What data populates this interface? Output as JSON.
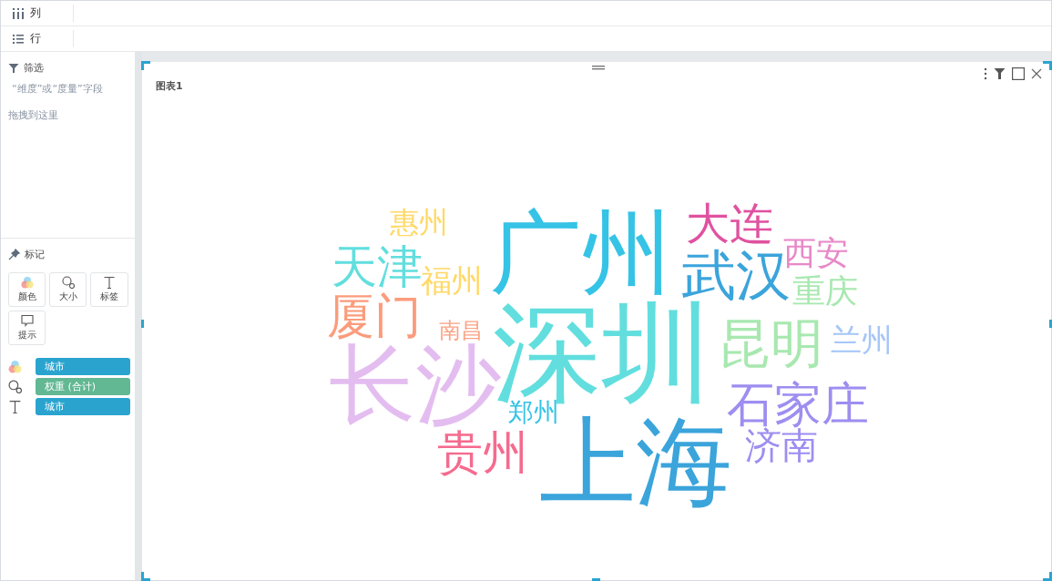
{
  "shelves": [
    {
      "kind": "columns",
      "label": "列"
    },
    {
      "kind": "rows",
      "label": "行"
    }
  ],
  "filter": {
    "title": "筛选",
    "hint": "“维度”或“度量”字段",
    "hint2": "拖拽到这里"
  },
  "marks": {
    "title": "标记",
    "buttons": [
      {
        "kind": "color",
        "label": "颜色"
      },
      {
        "kind": "size",
        "label": "大小"
      },
      {
        "kind": "label",
        "label": "标签"
      },
      {
        "kind": "tooltip",
        "label": "提示"
      }
    ],
    "fields": [
      {
        "kind": "color",
        "label": "城市",
        "color": "#2aa4cf"
      },
      {
        "kind": "size",
        "label": "权重 (合计)",
        "color": "#62b893"
      },
      {
        "kind": "label",
        "label": "城市",
        "color": "#2aa4cf"
      }
    ]
  },
  "chart": {
    "title": "图表1",
    "words": [
      {
        "text": "惠州",
        "color": "#ffd966"
      },
      {
        "text": "广州",
        "color": "#35c3e6"
      },
      {
        "text": "大连",
        "color": "#e052a0"
      },
      {
        "text": "天津",
        "color": "#62dede"
      },
      {
        "text": "福州",
        "color": "#ffd966"
      },
      {
        "text": "武汉",
        "color": "#3ba4db"
      },
      {
        "text": "西安",
        "color": "#e889c8"
      },
      {
        "text": "重庆",
        "color": "#a8e8b0"
      },
      {
        "text": "厦门",
        "color": "#fb9c7c"
      },
      {
        "text": "南昌",
        "color": "#f9a384"
      },
      {
        "text": "深圳",
        "color": "#62dede"
      },
      {
        "text": "昆明",
        "color": "#a8e8b0"
      },
      {
        "text": "兰州",
        "color": "#a6c6f8"
      },
      {
        "text": "长沙",
        "color": "#e4bdf0"
      },
      {
        "text": "郑州",
        "color": "#35c3e6"
      },
      {
        "text": "石家庄",
        "color": "#9d8ef0"
      },
      {
        "text": "贵州",
        "color": "#f56b8e"
      },
      {
        "text": "上海",
        "color": "#3ba4db"
      },
      {
        "text": "济南",
        "color": "#9d8ef0"
      }
    ]
  }
}
